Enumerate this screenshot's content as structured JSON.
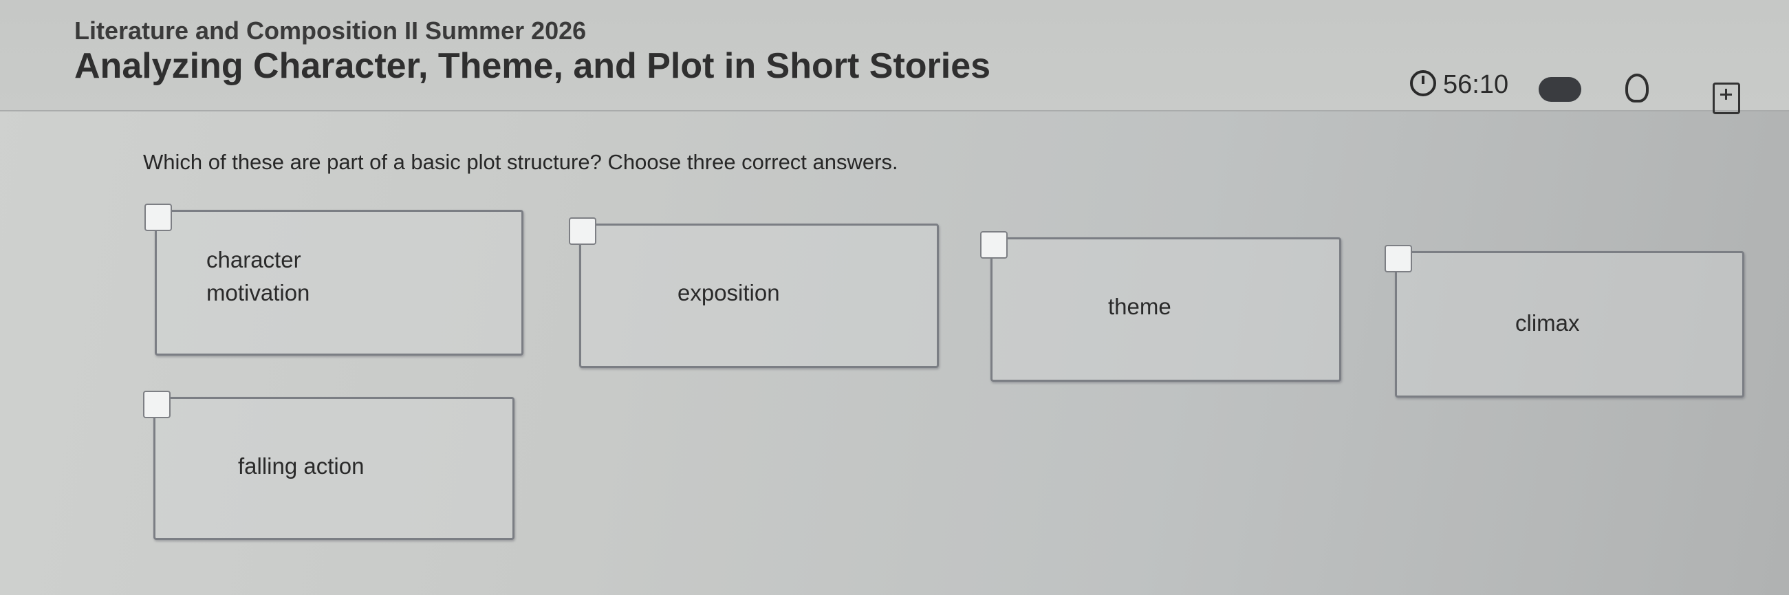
{
  "header": {
    "course_title": "Literature and Composition II Summer 2026",
    "lesson_title": "Analyzing Character, Theme, and Plot in Short Stories",
    "timer": "56:10"
  },
  "question": {
    "prompt": "Which of these are part of a basic plot structure? Choose three correct answers."
  },
  "choices": [
    {
      "label_line1": "character",
      "label_line2": "motivation",
      "checked": false
    },
    {
      "label": "exposition",
      "checked": false
    },
    {
      "label": "theme",
      "checked": false
    },
    {
      "label": "climax",
      "checked": false
    },
    {
      "label": "falling action",
      "checked": false
    }
  ],
  "icons": {
    "timer": "timer-icon",
    "toggle": "toggle-switch",
    "hint": "lightbulb-icon",
    "calculator": "calculator-icon"
  }
}
